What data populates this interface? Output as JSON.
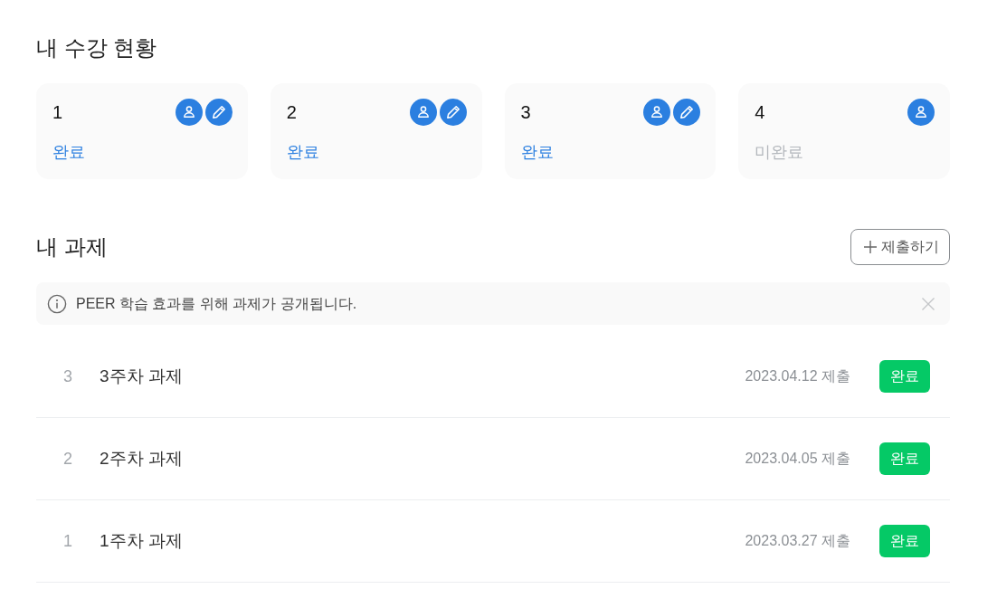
{
  "enrollment": {
    "title": "내 수강 현황",
    "courses": [
      {
        "number": "1",
        "status": "완료",
        "complete": true,
        "editable": true
      },
      {
        "number": "2",
        "status": "완료",
        "complete": true,
        "editable": true
      },
      {
        "number": "3",
        "status": "완료",
        "complete": true,
        "editable": true
      },
      {
        "number": "4",
        "status": "미완료",
        "complete": false,
        "editable": false
      }
    ]
  },
  "assignments": {
    "title": "내 과제",
    "submit_button": "제출하기",
    "notice": "PEER 학습 효과를 위해 과제가 공개됩니다.",
    "items": [
      {
        "number": "3",
        "title": "3주차 과제",
        "date": "2023.04.12 제출",
        "status": "완료"
      },
      {
        "number": "2",
        "title": "2주차 과제",
        "date": "2023.04.05 제출",
        "status": "완료"
      },
      {
        "number": "1",
        "title": "1주차 과제",
        "date": "2023.03.27 제출",
        "status": "완료"
      }
    ]
  }
}
